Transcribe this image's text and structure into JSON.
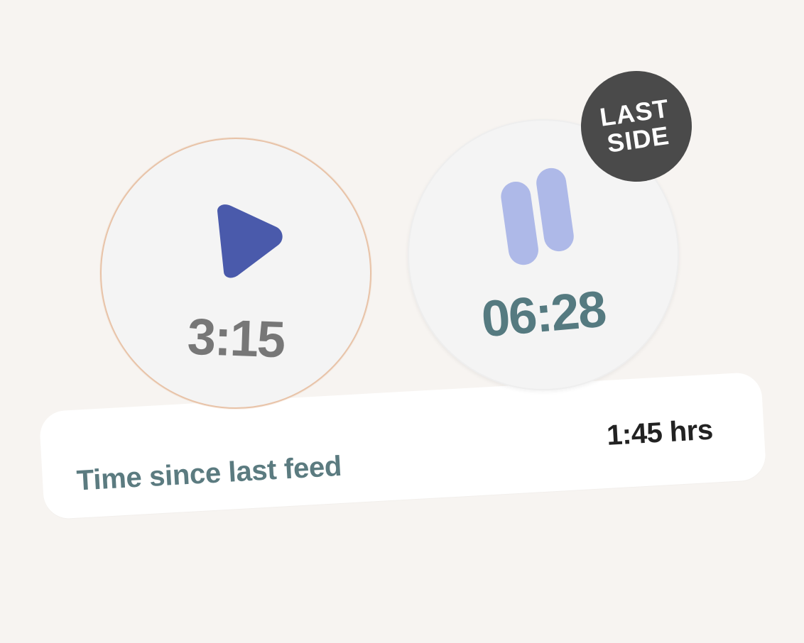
{
  "timers": {
    "left": {
      "time": "3:15",
      "control": "play-icon",
      "play_color": "#4a5aab"
    },
    "right": {
      "time": "06:28",
      "control": "pause-icon",
      "pause_color": "#aeb9e8",
      "badge": "LAST SIDE"
    }
  },
  "info": {
    "label": "Time since last feed",
    "value": "1:45 hrs"
  },
  "colors": {
    "background": "#f7f4f1",
    "card": "#ffffff",
    "accent_text": "#5b7b80",
    "badge_bg": "#4a4a4a"
  }
}
